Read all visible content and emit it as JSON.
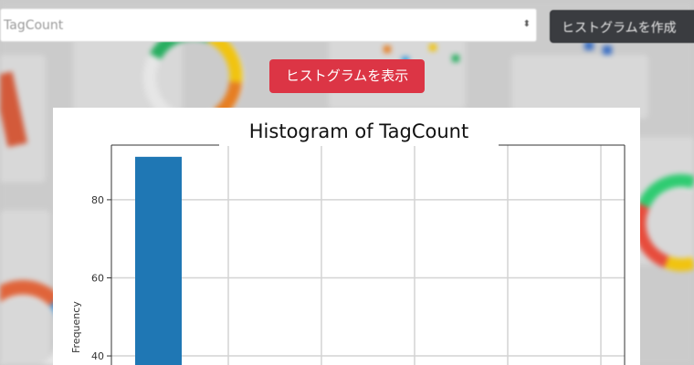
{
  "form": {
    "column_select": {
      "value": "TagCount",
      "caret": "⬍"
    },
    "create_button_label": "ヒストグラムを作成",
    "show_button_label": "ヒストグラムを表示"
  },
  "colors": {
    "accent_red": "#dc3545",
    "dark_button": "#3a3c40",
    "bar_blue": "#1f77b4"
  },
  "chart_data": {
    "type": "bar",
    "title": "Histogram of TagCount",
    "xlabel": "",
    "ylabel": "Frequency",
    "yticks": [
      40,
      60,
      80
    ],
    "ylim": [
      33,
      94
    ],
    "x_gridlines": 5,
    "grid": true,
    "series": [
      {
        "values": [
          91
        ]
      }
    ]
  }
}
